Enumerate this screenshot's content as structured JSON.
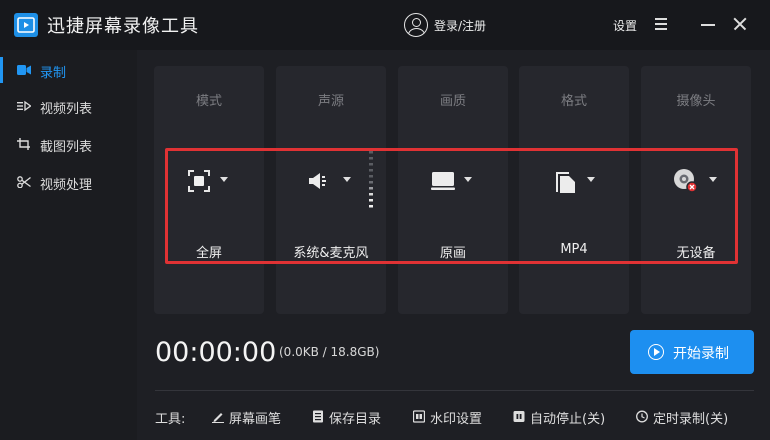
{
  "app": {
    "title": "迅捷屏幕录像工具",
    "login_label": "登录/注册",
    "settings_label": "设置"
  },
  "sidebar": {
    "items": [
      {
        "label": "录制",
        "icon": "video-camera-icon",
        "active": true
      },
      {
        "label": "视频列表",
        "icon": "video-list-icon",
        "active": false
      },
      {
        "label": "截图列表",
        "icon": "screenshot-list-icon",
        "active": false
      },
      {
        "label": "视频处理",
        "icon": "video-process-icon",
        "active": false
      }
    ]
  },
  "options": [
    {
      "header": "模式",
      "value": "全屏",
      "icon": "fullscreen-icon"
    },
    {
      "header": "声源",
      "value": "系统&麦克风",
      "icon": "speaker-icon"
    },
    {
      "header": "画质",
      "value": "原画",
      "icon": "monitor-icon"
    },
    {
      "header": "格式",
      "value": "MP4",
      "icon": "file-icon"
    },
    {
      "header": "摄像头",
      "value": "无设备",
      "icon": "webcam-icon"
    }
  ],
  "recording": {
    "timer": "00:00:00",
    "size_info": "(0.0KB / 18.8GB)",
    "start_label": "开始录制"
  },
  "tools": {
    "label": "工具:",
    "items": [
      {
        "label": "屏幕画笔",
        "icon": "pen-icon"
      },
      {
        "label": "保存目录",
        "icon": "folder-icon"
      },
      {
        "label": "水印设置",
        "icon": "watermark-icon"
      },
      {
        "label": "自动停止(关)",
        "icon": "auto-stop-icon"
      },
      {
        "label": "定时录制(关)",
        "icon": "clock-icon"
      }
    ]
  },
  "colors": {
    "accent": "#1d8ff0",
    "highlight": "#e03234",
    "background": "#1e1f24",
    "card": "#26272d"
  }
}
